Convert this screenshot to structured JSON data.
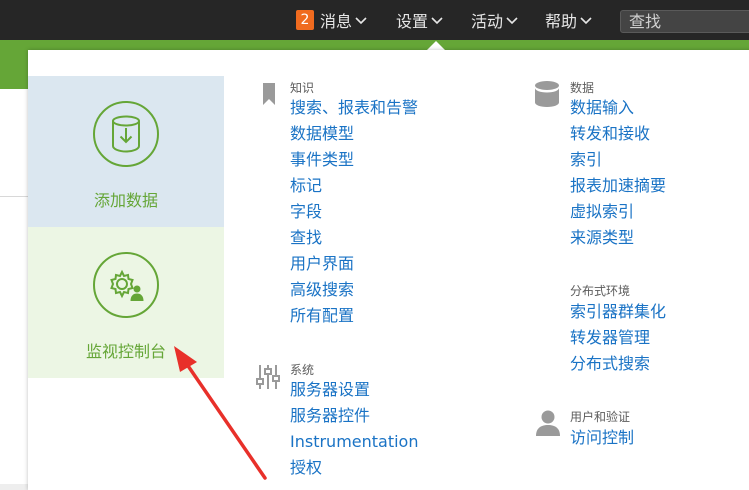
{
  "topnav": {
    "messages_badge": "2",
    "messages_label": "消息",
    "settings_label": "设置",
    "activity_label": "活动",
    "help_label": "帮助",
    "search_label": "查找"
  },
  "tiles": {
    "add_data": "添加数据",
    "monitoring_console": "监视控制台"
  },
  "knowledge": {
    "title": "知识",
    "items": [
      "搜索、报表和告警",
      "数据模型",
      "事件类型",
      "标记",
      "字段",
      "查找",
      "用户界面",
      "高级搜索",
      "所有配置"
    ]
  },
  "system": {
    "title": "系统",
    "items": [
      "服务器设置",
      "服务器控件",
      "Instrumentation",
      "授权"
    ]
  },
  "data": {
    "title": "数据",
    "items": [
      "数据输入",
      "转发和接收",
      "索引",
      "报表加速摘要",
      "虚拟索引",
      "来源类型"
    ]
  },
  "distributed": {
    "title": "分布式环境",
    "items": [
      "索引器群集化",
      "转发器管理",
      "分布式搜索"
    ]
  },
  "users_auth": {
    "title": "用户和验证",
    "items": [
      "访问控制"
    ]
  },
  "colors": {
    "topbar": "#262626",
    "accent_green": "#65a637",
    "link_blue": "#1a73c5",
    "badge_orange": "#f06b1f",
    "annotation_red": "#e8302a"
  }
}
